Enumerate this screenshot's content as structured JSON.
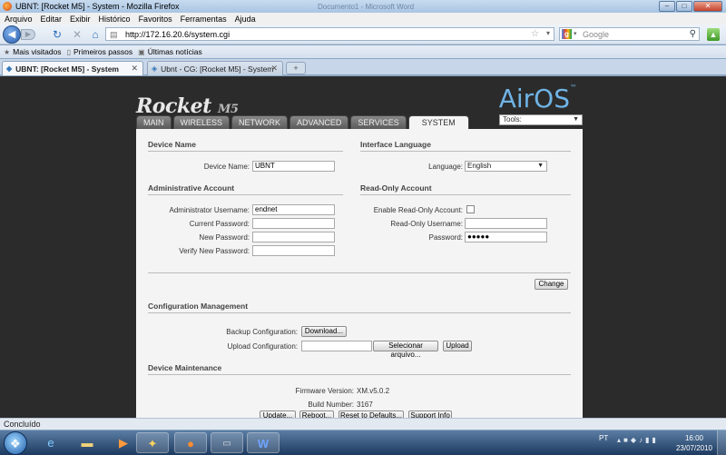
{
  "window": {
    "title": "UBNT: [Rocket M5] - System - Mozilla Firefox",
    "background_title": "Documento1 - Microsoft Word"
  },
  "menu": [
    "Arquivo",
    "Editar",
    "Exibir",
    "Histórico",
    "Favoritos",
    "Ferramentas",
    "Ajuda"
  ],
  "address": {
    "url": "http://172.16.20.6/system.cgi",
    "search_placeholder": "Google"
  },
  "bookmarks": [
    "Mais visitados",
    "Primeiros passos",
    "Últimas notícias"
  ],
  "tabs": [
    {
      "label": "UBNT: [Rocket M5] - System",
      "active": true
    },
    {
      "label": "Ubnt - CG: [Rocket M5] - System",
      "active": false
    }
  ],
  "device_header": {
    "logo_main": "Rocket",
    "logo_sub": "M5",
    "brand": "AirOS",
    "brand_tm": "™",
    "tools_label": "Tools:"
  },
  "nav_tabs": [
    "MAIN",
    "WIRELESS",
    "NETWORK",
    "ADVANCED",
    "SERVICES",
    "SYSTEM"
  ],
  "sections": {
    "device_name": "Device Name",
    "interface_language": "Interface Language",
    "admin_account": "Administrative Account",
    "readonly_account": "Read-Only Account",
    "config_mgmt": "Configuration Management",
    "device_maint": "Device Maintenance"
  },
  "fields": {
    "device_name_label": "Device Name:",
    "device_name_value": "UBNT",
    "language_label": "Language:",
    "language_value": "English",
    "admin_user_label": "Administrator Username:",
    "admin_user_value": "endnet",
    "current_pw_label": "Current Password:",
    "new_pw_label": "New Password:",
    "verify_pw_label": "Verify New Password:",
    "enable_ro_label": "Enable Read-Only Account:",
    "ro_user_label": "Read-Only Username:",
    "ro_pw_label": "Password:",
    "ro_pw_value": "●●●●●",
    "backup_label": "Backup Configuration:",
    "upload_label": "Upload Configuration:",
    "firmware_label": "Firmware Version:",
    "firmware_value": "XM.v5.0.2",
    "build_label": "Build Number:",
    "build_value": "3167"
  },
  "buttons": {
    "change": "Change",
    "download": "Download...",
    "select_file": "Selecionar arquivo...",
    "upload": "Upload",
    "update": "Update...",
    "reboot": "Reboot...",
    "reset": "Reset to Defaults...",
    "support": "Support Info"
  },
  "status": "Concluído",
  "taskbar": {
    "language": "PT",
    "time": "16:00",
    "date": "23/07/2010"
  }
}
